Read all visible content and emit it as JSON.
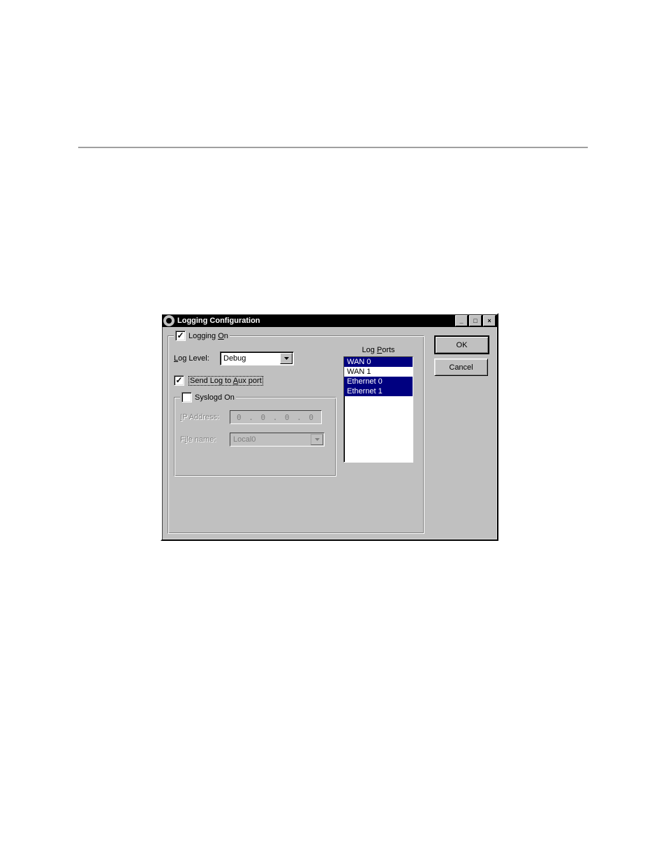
{
  "window": {
    "title": "Logging Configuration"
  },
  "logging_on": {
    "checked": true,
    "label_pre": "Logging ",
    "label_u": "O",
    "label_post": "n"
  },
  "log_level": {
    "label_u": "L",
    "label_post": "og Level:",
    "value": "Debug"
  },
  "send_aux": {
    "checked": true,
    "label_pre": "Send Log to ",
    "label_u": "A",
    "label_post": "ux port"
  },
  "syslogd": {
    "checked": false,
    "label": "Syslogd On"
  },
  "ip": {
    "label_u": "I",
    "label_post": "P Address:",
    "value": "0   .   0   .   0   .   0"
  },
  "filename": {
    "label_pre": "F",
    "label_u": "i",
    "label_post": "le name:",
    "value": "Local0"
  },
  "log_ports": {
    "label_pre": "Log ",
    "label_u": "P",
    "label_post": "orts",
    "items": [
      {
        "text": "WAN 0",
        "selected": true
      },
      {
        "text": "WAN 1",
        "selected": false
      },
      {
        "text": "Ethernet 0",
        "selected": true
      },
      {
        "text": "Ethernet 1",
        "selected": true
      }
    ]
  },
  "buttons": {
    "ok": "OK",
    "cancel": "Cancel"
  }
}
